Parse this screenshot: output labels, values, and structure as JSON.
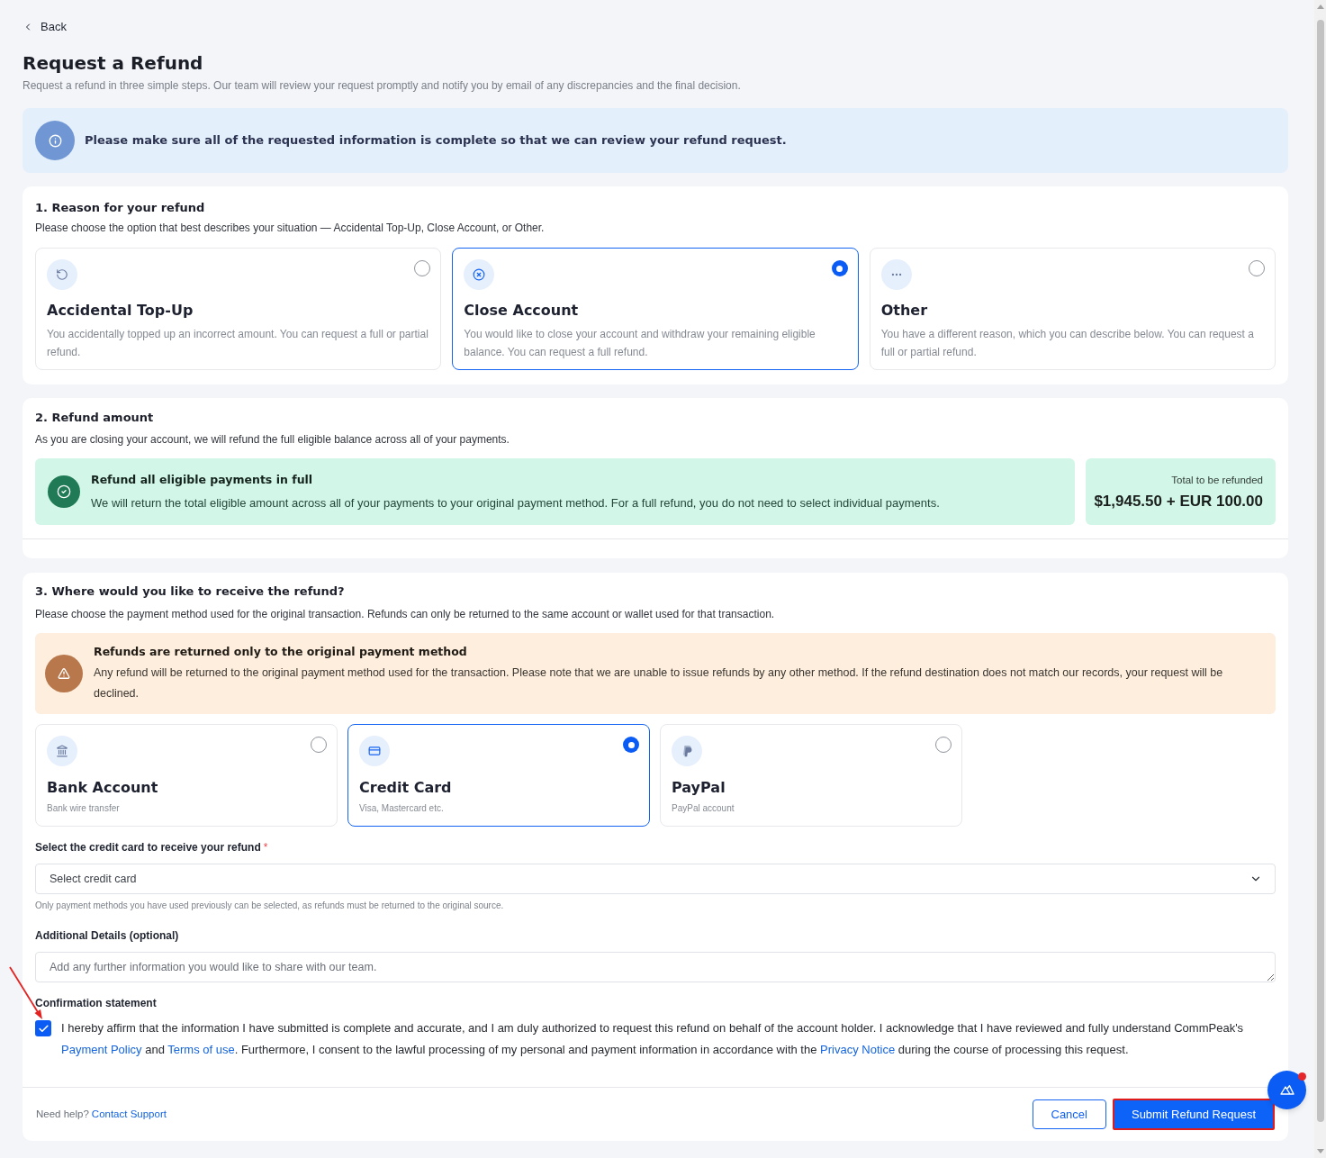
{
  "back": {
    "label": "Back"
  },
  "page": {
    "title": "Request a Refund",
    "subtitle": "Request a refund in three simple steps. Our team will review your request promptly and notify you by email of any discrepancies and the final decision."
  },
  "info_banner": {
    "text": "Please make sure all of the requested information is complete so that we can review your refund request."
  },
  "reason": {
    "heading": "1. Reason for your refund",
    "description": "Please choose the option that best describes your situation — Accidental Top-Up, Close Account, or Other.",
    "options": [
      {
        "title": "Accidental Top-Up",
        "description": "You accidentally topped up an incorrect amount. You can request a full or partial refund.",
        "selected": false
      },
      {
        "title": "Close Account",
        "description": "You would like to close your account and withdraw your remaining eligible balance. You can request a full refund.",
        "selected": true
      },
      {
        "title": "Other",
        "description": "You have a different reason, which you can describe below. You can request a full or partial refund.",
        "selected": false
      }
    ]
  },
  "amount": {
    "heading": "2. Refund amount",
    "description": "As you are closing your account, we will refund the full eligible balance across all of your payments.",
    "notice": {
      "title": "Refund all eligible payments in full",
      "text": "We will return the total eligible amount across all of your payments to your original payment method. For a full refund, you do not need to select individual payments."
    },
    "total": {
      "label": "Total to be refunded",
      "value": "$1,945.50 + EUR 100.00"
    }
  },
  "destination": {
    "heading": "3. Where would you like to receive the refund?",
    "description": "Please choose the payment method used for the original transaction. Refunds can only be returned to the same account or wallet used for that transaction.",
    "warning": {
      "title": "Refunds are returned only to the original payment method",
      "text": "Any refund will be returned to the original payment method used for the transaction. Please note that we are unable to issue refunds by any other method. If the refund destination does not match our records, your request will be declined."
    },
    "methods": [
      {
        "title": "Bank Account",
        "subtitle": "Bank wire transfer",
        "selected": false
      },
      {
        "title": "Credit Card",
        "subtitle": "Visa, Mastercard etc.",
        "selected": true
      },
      {
        "title": "PayPal",
        "subtitle": "PayPal account",
        "selected": false
      }
    ]
  },
  "card_select": {
    "label": "Select the credit card to receive your refund",
    "required_mark": "*",
    "placeholder": "Select credit card",
    "hint": "Only payment methods you have used previously can be selected, as refunds must be returned to the original source."
  },
  "details": {
    "label": "Additional Details (optional)",
    "placeholder": "Add any further information you would like to share with our team."
  },
  "confirmation": {
    "label": "Confirmation statement",
    "checked": true,
    "pointer_arrow": true,
    "parts": [
      {
        "kind": "text",
        "text": "I hereby affirm that the information I have submitted is complete and accurate, and I am duly authorized to request this refund on behalf of the account holder. I acknowledge that I have reviewed and fully understand CommPeak's "
      },
      {
        "kind": "link",
        "text": "Payment Policy"
      },
      {
        "kind": "text",
        "text": " and "
      },
      {
        "kind": "link",
        "text": "Terms of use"
      },
      {
        "kind": "text",
        "text": ". Furthermore, I consent to the lawful processing of my personal and payment information in accordance with the "
      },
      {
        "kind": "link",
        "text": "Privacy Notice"
      },
      {
        "kind": "text",
        "text": " during the course of processing this request."
      }
    ]
  },
  "footer": {
    "help_text": "Need help?",
    "help_link": "Contact Support",
    "buttons": [
      {
        "kind": "secondary",
        "label": "Cancel",
        "highlighted": false
      },
      {
        "kind": "primary",
        "label": "Submit Refund Request",
        "highlighted": true
      }
    ]
  },
  "chat_button": {
    "unread": true
  }
}
